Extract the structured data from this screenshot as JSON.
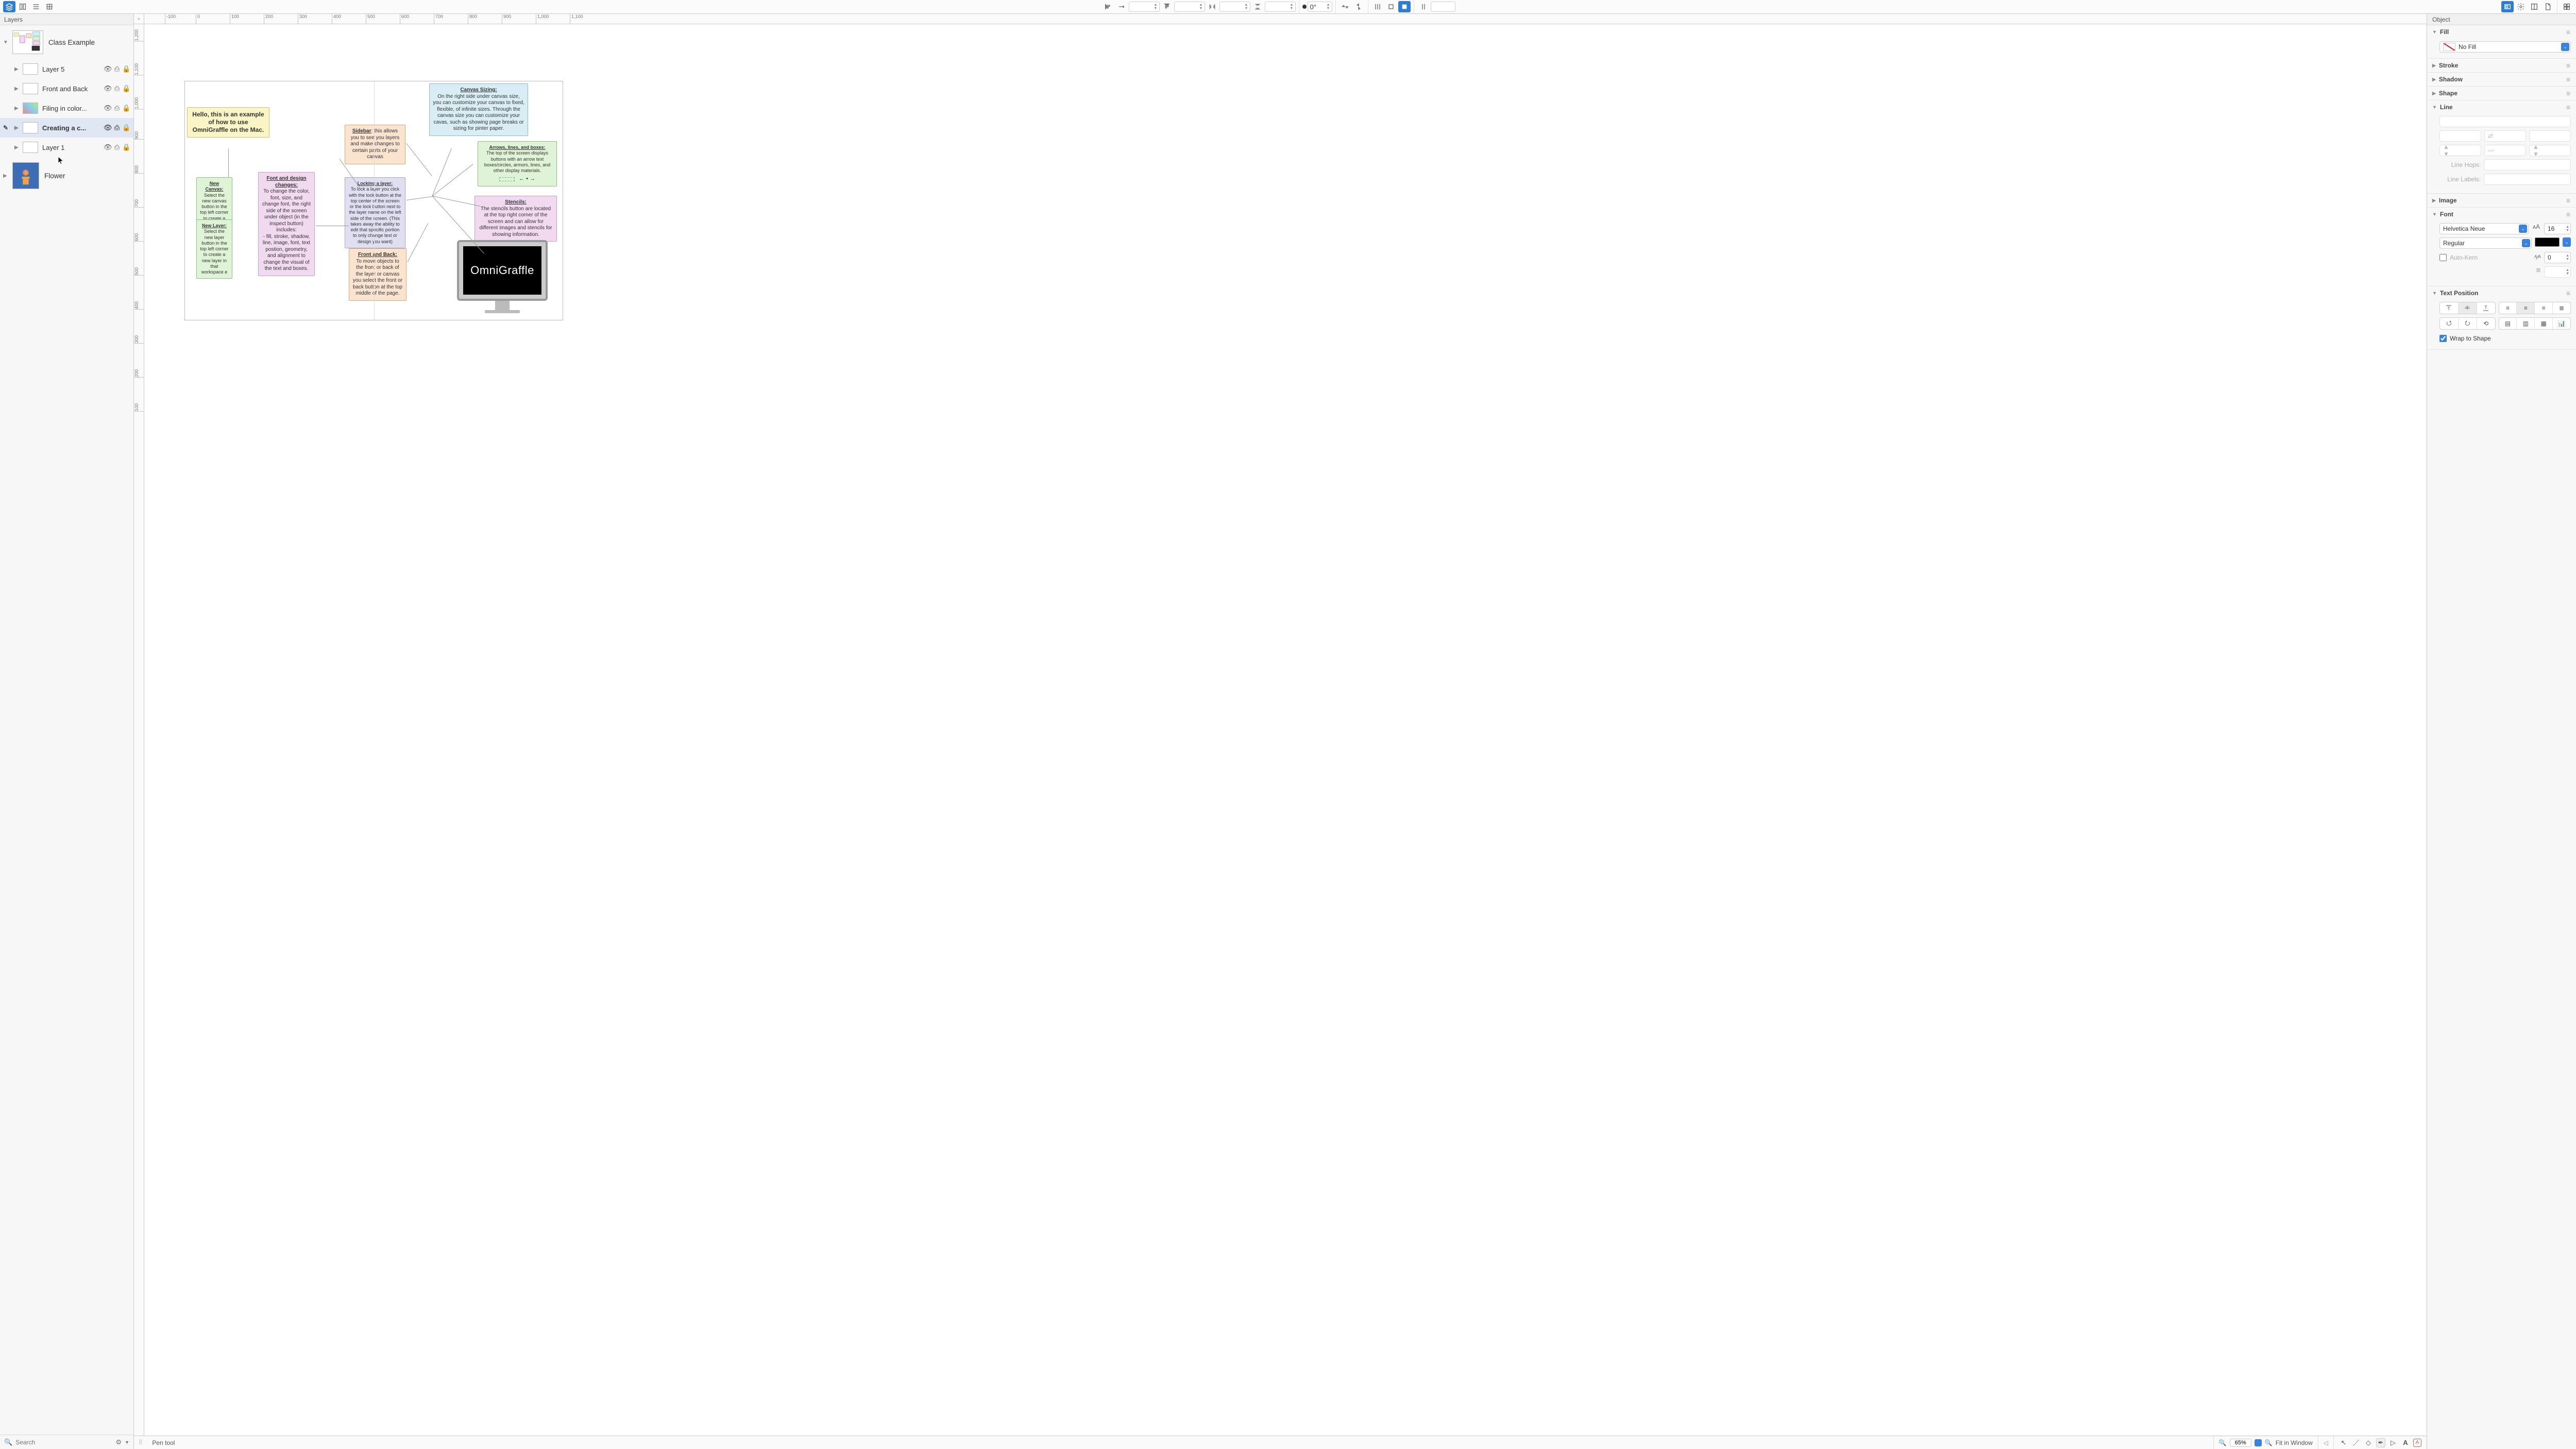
{
  "sidebar": {
    "header": "Layers",
    "search_placeholder": "Search",
    "canvases": [
      {
        "name": "Class Example",
        "expanded": true
      },
      {
        "name": "Flower",
        "expanded": false
      }
    ],
    "layers": [
      {
        "name": "Layer 5"
      },
      {
        "name": "Front and Back"
      },
      {
        "name": "Filing in color..."
      },
      {
        "name": "Creating a c...",
        "selected": true,
        "editing": true
      },
      {
        "name": "Layer 1"
      }
    ]
  },
  "canvas": {
    "ruler_h": [
      "-100",
      "0",
      "100",
      "200",
      "300",
      "400",
      "500",
      "600",
      "700",
      "800",
      "900",
      "1,000",
      "1,100"
    ],
    "ruler_v": [
      "1,200",
      "1,100",
      "1,000",
      "900",
      "800",
      "700",
      "600",
      "500",
      "400",
      "300",
      "200",
      "100"
    ],
    "nodes": {
      "hello": "Hello, this is an example of how to use OmniGraffle on the Mac.",
      "font_title": "Font and design changes:",
      "font_body": "To change the color, font, size, and change font, the right side of the screen under object (in the inspect button) includes:\n- fill, stroke, shadow, line, image, font, text postion, geometry, and alignment to change the visual of the text and boxes.",
      "newcanvas_title": "New Canvas:",
      "newcanvas_body": "Select the new canvas button in the top left corner to create a new canvas for your workspace",
      "newlayer_title": "New Layer:",
      "newlayer_body": "Select the new layer button in the top left corner to create a new layer in that workspace e",
      "sidebar_title": "Sidebar",
      "sidebar_body": ": this allows you to see you layers and make changes to certain parts of your canvas",
      "lock_title": "Locking a layer:",
      "lock_body": "To lock a layer you click with the lock button at the top center of the screen or the lock button next to the layer name on the left side of the screen. (This takes away the ability to edit that specific portion to only change text or design you want)",
      "front_title": "Front and Back:",
      "front_body": "To move objects to the front or back of the layer or canvas you select the front or back button at the top middle of the page.",
      "sizing_title": "Canvas Sizing:",
      "sizing_body": "On the right side under canvas size, you can customize your canvas to fixed, flexible, of infinite sizes.  Through the canvas size you can customize your cavas, such as showing page breaks or sizing for pinter paper.",
      "arrows_title": "Arrows, lines, and boxes:",
      "arrows_body": "The top of the screen displays buttons with an arrow text boxes/circles, armors, lines, and other display materials.",
      "stencils_title": "Stencils:",
      "stencils_body": "The stencils button are located at the top right corner of the screen and can allow for different images and stencils for showing information.",
      "monitor": "OmniGraffle"
    }
  },
  "status": {
    "tool": "Pen tool",
    "zoom": "65%",
    "fit": "Fit in Window"
  },
  "inspector": {
    "header": "Object",
    "fill": {
      "title": "Fill",
      "value": "No Fill"
    },
    "stroke": {
      "title": "Stroke"
    },
    "shadow": {
      "title": "Shadow"
    },
    "shape": {
      "title": "Shape"
    },
    "line": {
      "title": "Line",
      "hops": "Line Hops:",
      "labels": "Line Labels:"
    },
    "image": {
      "title": "Image"
    },
    "font": {
      "title": "Font",
      "family": "Helvetica Neue",
      "weight": "Regular",
      "size": "16",
      "kern_label": "Auto-Kern",
      "kern": "0"
    },
    "textpos": {
      "title": "Text Position",
      "wrap": "Wrap to Shape"
    }
  },
  "toolbar": {
    "rotation": "0°"
  }
}
